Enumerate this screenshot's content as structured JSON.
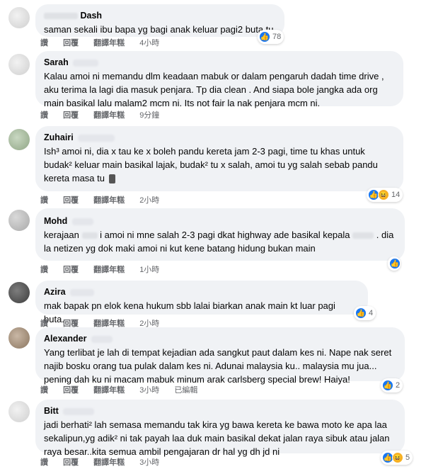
{
  "actions": {
    "like": "讚",
    "reply": "回覆",
    "translate": "翻譯年糕",
    "edited": "已編輯"
  },
  "comments": [
    {
      "author": "Dash",
      "text": "saman sekali ibu bapa yg bagi anak keluar pagi2 buta tu",
      "time": "4小時",
      "reaction_count": "78"
    },
    {
      "author": "Sarah",
      "text": "Kalau amoi ni memandu dlm keadaan mabuk or dalam pengaruh dadah time drive , aku terima la lagi dia masuk penjara. Tp dia clean . And siapa bole jangka ada org main basikal lalu malam2 mcm ni. Its not fair la nak penjara mcm ni.",
      "time": "9分鐘",
      "reaction_count": ""
    },
    {
      "author": "Zuhairi",
      "text": "Ish³ amoi ni, dia x tau ke x boleh pandu kereta jam 2-3 pagi, time tu khas untuk budak² keluar main basikal lajak, budak² tu x salah, amoi tu yg salah sebab pandu kereta masa tu",
      "time": "2小時",
      "reaction_count": "14"
    },
    {
      "author": "Mohd",
      "text_a": "kerajaan",
      "text_b": "i amoi ni mne salah 2-3 pagi dkat highway ade basikal kepala",
      "text_c": ". dia la netizen yg dok maki amoi ni kut kene batang hidung bukan main",
      "time": "1小時",
      "reaction_count": ""
    },
    {
      "author": "Azira",
      "text": "mak bapak pn elok kena hukum sbb lalai biarkan anak main kt luar pagi buta..",
      "time": "2小時",
      "reaction_count": "4"
    },
    {
      "author": "Alexander",
      "text": "Yang terlibat je lah di tempat kejadian ada sangkut paut dalam kes ni. Nape nak seret najib bosku orang tua pulak dalam kes ni. Adunai malaysia ku.. malaysia mu jua... pening dah ku ni macam mabuk minum arak carlsberg special brew! Haiya!",
      "time": "3小時",
      "reaction_count": "2"
    },
    {
      "author": "Bitt",
      "text": "jadi berhati² lah semasa memandu tak kira yg bawa kereta ke bawa moto ke apa laa sekalipun,yg adik² ni tak payah laa duk main basikal dekat jalan raya sibuk atau jalan raya besar..kita semua ambil pengajaran dr hal yg dh jd ni",
      "time": "3小時",
      "reaction_count": "5"
    }
  ]
}
